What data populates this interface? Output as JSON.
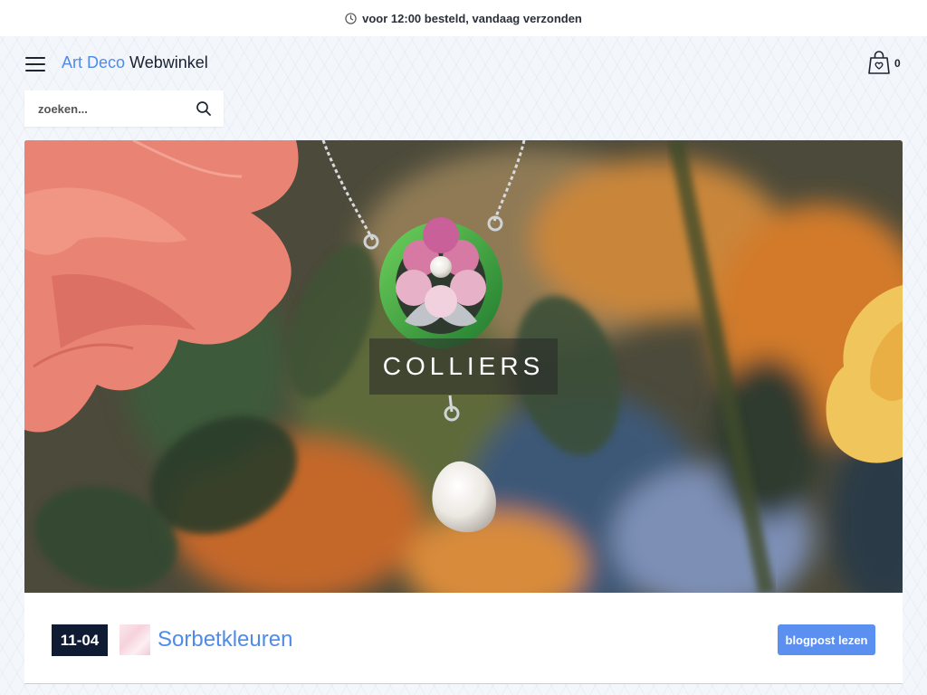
{
  "topbar": {
    "notice": "voor 12:00 besteld, vandaag verzonden",
    "icon": "clock-icon"
  },
  "header": {
    "logo_part1": "Art Deco",
    "logo_part2": "Webwinkel",
    "cart_count": "0",
    "menu_icon": "hamburger-menu-icon",
    "cart_icon": "shopping-bag-heart-icon"
  },
  "search": {
    "placeholder": "zoeken...",
    "icon": "search-icon"
  },
  "hero": {
    "label": "COLLIERS"
  },
  "blog": {
    "date": "11-04",
    "title": "Sorbetkleuren",
    "button_label": "blogpost lezen"
  },
  "colors": {
    "accent_blue": "#4f8be8",
    "button_blue": "#5b8ff0",
    "badge_navy": "#0f1b33",
    "page_bg": "#f3f6fa"
  }
}
